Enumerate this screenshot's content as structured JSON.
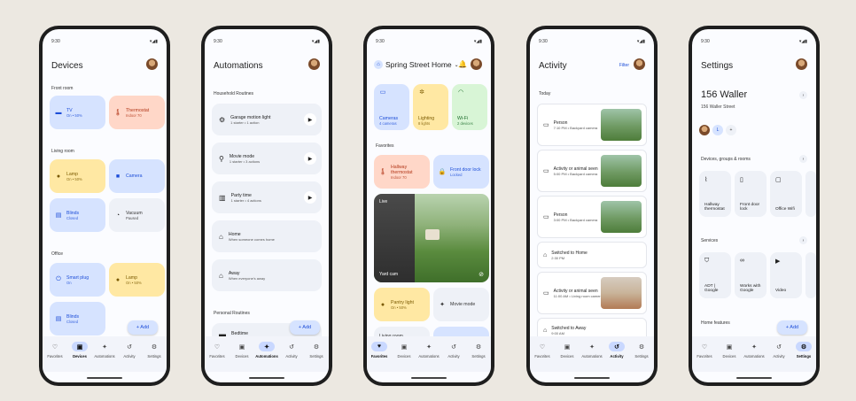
{
  "status_time": "9:30",
  "status_icons": "▾◢▮",
  "nav": {
    "favorites": "Favorites",
    "devices": "Devices",
    "automations": "Automations",
    "activity": "Activity",
    "settings": "Settings"
  },
  "add_label": "+  Add",
  "devices": {
    "title": "Devices",
    "front_room": "Front room",
    "tv": {
      "name": "TV",
      "sub": "On • 50%"
    },
    "thermostat": {
      "name": "Thermostat",
      "sub": "Indoor 70"
    },
    "living_room": "Living room",
    "lamp": {
      "name": "Lamp",
      "sub": "On • 50%"
    },
    "camera": {
      "name": "Camera"
    },
    "blinds": {
      "name": "Blinds",
      "sub": "Closed"
    },
    "vacuum": {
      "name": "Vacuum",
      "sub": "Paused"
    },
    "office": "Office",
    "smart_plug": {
      "name": "Smart plug",
      "sub": "On"
    },
    "office_lamp": {
      "name": "Lamp",
      "sub": "On • 50%"
    },
    "office_blinds": {
      "name": "Blinds",
      "sub": "Closed"
    }
  },
  "automations": {
    "title": "Automations",
    "household": "Household Routines",
    "items": [
      {
        "name": "Garage motion light",
        "sub": "1 starter • 1 action"
      },
      {
        "name": "Movie mode",
        "sub": "1 starter • 3 actions"
      },
      {
        "name": "Party time",
        "sub": "1 starter • 4 actions"
      },
      {
        "name": "Home",
        "sub": "When someone comes home"
      },
      {
        "name": "Away",
        "sub": "When everyone's away"
      }
    ],
    "personal": "Personal Routines",
    "bedtime": "Bedtime"
  },
  "favorites": {
    "home_name": "Spring Street Home",
    "cameras": {
      "name": "Cameras",
      "sub": "4 cameras"
    },
    "lighting": {
      "name": "Lighting",
      "sub": "8 lights"
    },
    "wifi": {
      "name": "Wi-Fi",
      "sub": "2 devices"
    },
    "section": "Favorites",
    "hallway": {
      "name": "Hallway thermostat",
      "sub": "Indoor 70"
    },
    "front_door": {
      "name": "Front door lock",
      "sub": "Locked"
    },
    "live": "Live",
    "yard_cam": "Yard cam",
    "pantry": {
      "name": "Pantry light",
      "sub": "On • 50%"
    },
    "movie_mode": "Movie mode",
    "living_room": "Living room"
  },
  "activity": {
    "title": "Activity",
    "filter": "Filter",
    "today": "Today",
    "items": [
      {
        "name": "Person",
        "sub": "7:10 PM • Backyard camera"
      },
      {
        "name": "Activity or animal seen",
        "sub": "5:00 PM • Backyard camera"
      },
      {
        "name": "Person",
        "sub": "3:00 PM • Backyard camera"
      },
      {
        "name": "Switched to Home",
        "sub": "2:30 PM"
      },
      {
        "name": "Activity or animal seen",
        "sub": "11:00 AM • Living room camera"
      },
      {
        "name": "Switched to Away",
        "sub": "9:00 AM"
      }
    ]
  },
  "settings": {
    "title": "Settings",
    "home_name": "156 Waller",
    "address": "156 Waller Street",
    "member_initial": "L",
    "devices_groups": "Devices, groups & rooms",
    "devices": [
      "Hallway thermostat",
      "Front door lock",
      "Office Wifi"
    ],
    "services": "Services",
    "service_items": [
      "ADT | Google",
      "Works with Google",
      "Video"
    ],
    "home_features": "Home features"
  }
}
